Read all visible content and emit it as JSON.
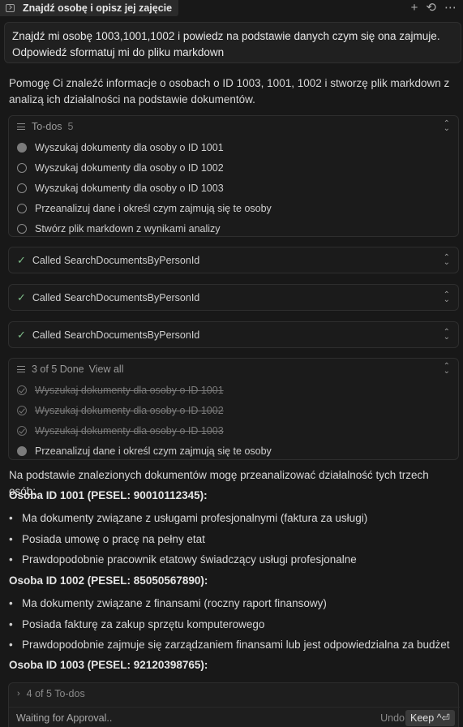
{
  "tab": {
    "title": "Znajdź osobę i opisz jej zajęcie",
    "icon": "terminal-icon"
  },
  "top_actions": [
    "plus-icon",
    "history-icon",
    "more-icon"
  ],
  "user_message": {
    "line1": "Znajdź mi osobę 1003,1001,1002 i powiedz na podstawie danych czym się ona zajmuje.",
    "line2": "Odpowiedź sformatuj mi do pliku markdown"
  },
  "intro": {
    "line1": "Pomogę Ci znaleźć informacje o osobach o ID 1003, 1001, 1002 i stworzę plik markdown z",
    "line2": "analizą ich działalności na podstawie dokumentów."
  },
  "todos_card": {
    "label": "To-dos",
    "count": "5",
    "items": [
      {
        "text": "Wyszukaj dokumenty dla osoby o ID 1001",
        "state": "in-progress"
      },
      {
        "text": "Wyszukaj dokumenty dla osoby o ID 1002",
        "state": "pending"
      },
      {
        "text": "Wyszukaj dokumenty dla osoby o ID 1003",
        "state": "pending"
      },
      {
        "text": "Przeanalizuj dane i określ czym zajmują się te osoby",
        "state": "pending"
      },
      {
        "text": "Stwórz plik markdown z wynikami analizy",
        "state": "pending"
      }
    ]
  },
  "tool_calls": [
    {
      "label": "Called SearchDocumentsByPersonId"
    },
    {
      "label": "Called SearchDocumentsByPersonId"
    },
    {
      "label": "Called SearchDocumentsByPersonId"
    }
  ],
  "progress_card": {
    "label": "3 of 5 Done",
    "view_all": "View all",
    "items": [
      {
        "text": "Wyszukaj dokumenty dla osoby o ID 1001",
        "state": "done"
      },
      {
        "text": "Wyszukaj dokumenty dla osoby o ID 1002",
        "state": "done"
      },
      {
        "text": "Wyszukaj dokumenty dla osoby o ID 1003",
        "state": "done"
      },
      {
        "text": "Przeanalizuj dane i określ czym zajmują się te osoby",
        "state": "in-progress"
      }
    ]
  },
  "analysis": {
    "intro": "Na podstawie znalezionych dokumentów mogę przeanalizować działalność tych trzech osób:",
    "persons": [
      {
        "heading": "Osoba ID 1001 (PESEL: 90010112345):",
        "bullets": [
          "Ma dokumenty związane z usługami profesjonalnymi (faktura za usługi)",
          "Posiada umowę o pracę na pełny etat",
          "Prawdopodobnie pracownik etatowy świadczący usługi profesjonalne"
        ]
      },
      {
        "heading": "Osoba ID 1002 (PESEL: 85050567890):",
        "bullets": [
          "Ma dokumenty związane z finansami (roczny raport finansowy)",
          "Posiada fakturę za zakup sprzętu komputerowego",
          "Prawdopodobnie zajmuje się zarządzaniem finansami lub jest odpowiedzialna za budżet"
        ]
      },
      {
        "heading": "Osoba ID 1003 (PESEL: 92120398765):",
        "bullets": []
      }
    ]
  },
  "composer": {
    "todos_summary": "4 of 5 To-dos",
    "status": "Waiting for Approval..",
    "undo_label": "Undo",
    "keep_label": "Keep ^⏎"
  }
}
